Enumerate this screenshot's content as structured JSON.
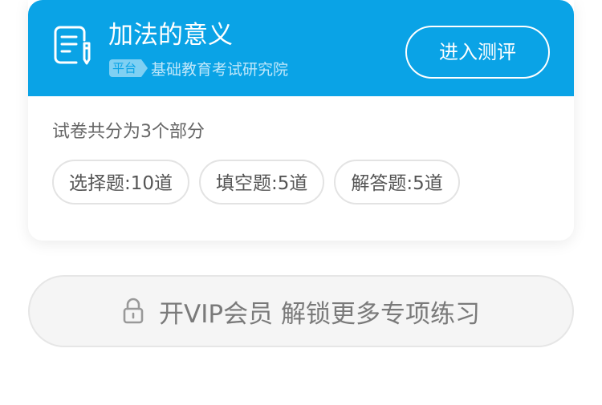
{
  "header": {
    "title": "加法的意义",
    "platform_tag": "平台",
    "org_name": "基础教育考试研究院",
    "enter_button": "进入测评",
    "doc_icon": "document-edit-icon"
  },
  "summary": {
    "text": "试卷共分为3个部分"
  },
  "sections": [
    {
      "label": "选择题:10道"
    },
    {
      "label": "填空题:5道"
    },
    {
      "label": "解答题:5道"
    }
  ],
  "vip": {
    "label": "开VIP会员 解锁更多专项练习",
    "icon": "lock-icon"
  },
  "colors": {
    "header_bg": "#0aa3e6",
    "text_gray": "#666666",
    "vip_bg": "#f5f5f5"
  }
}
